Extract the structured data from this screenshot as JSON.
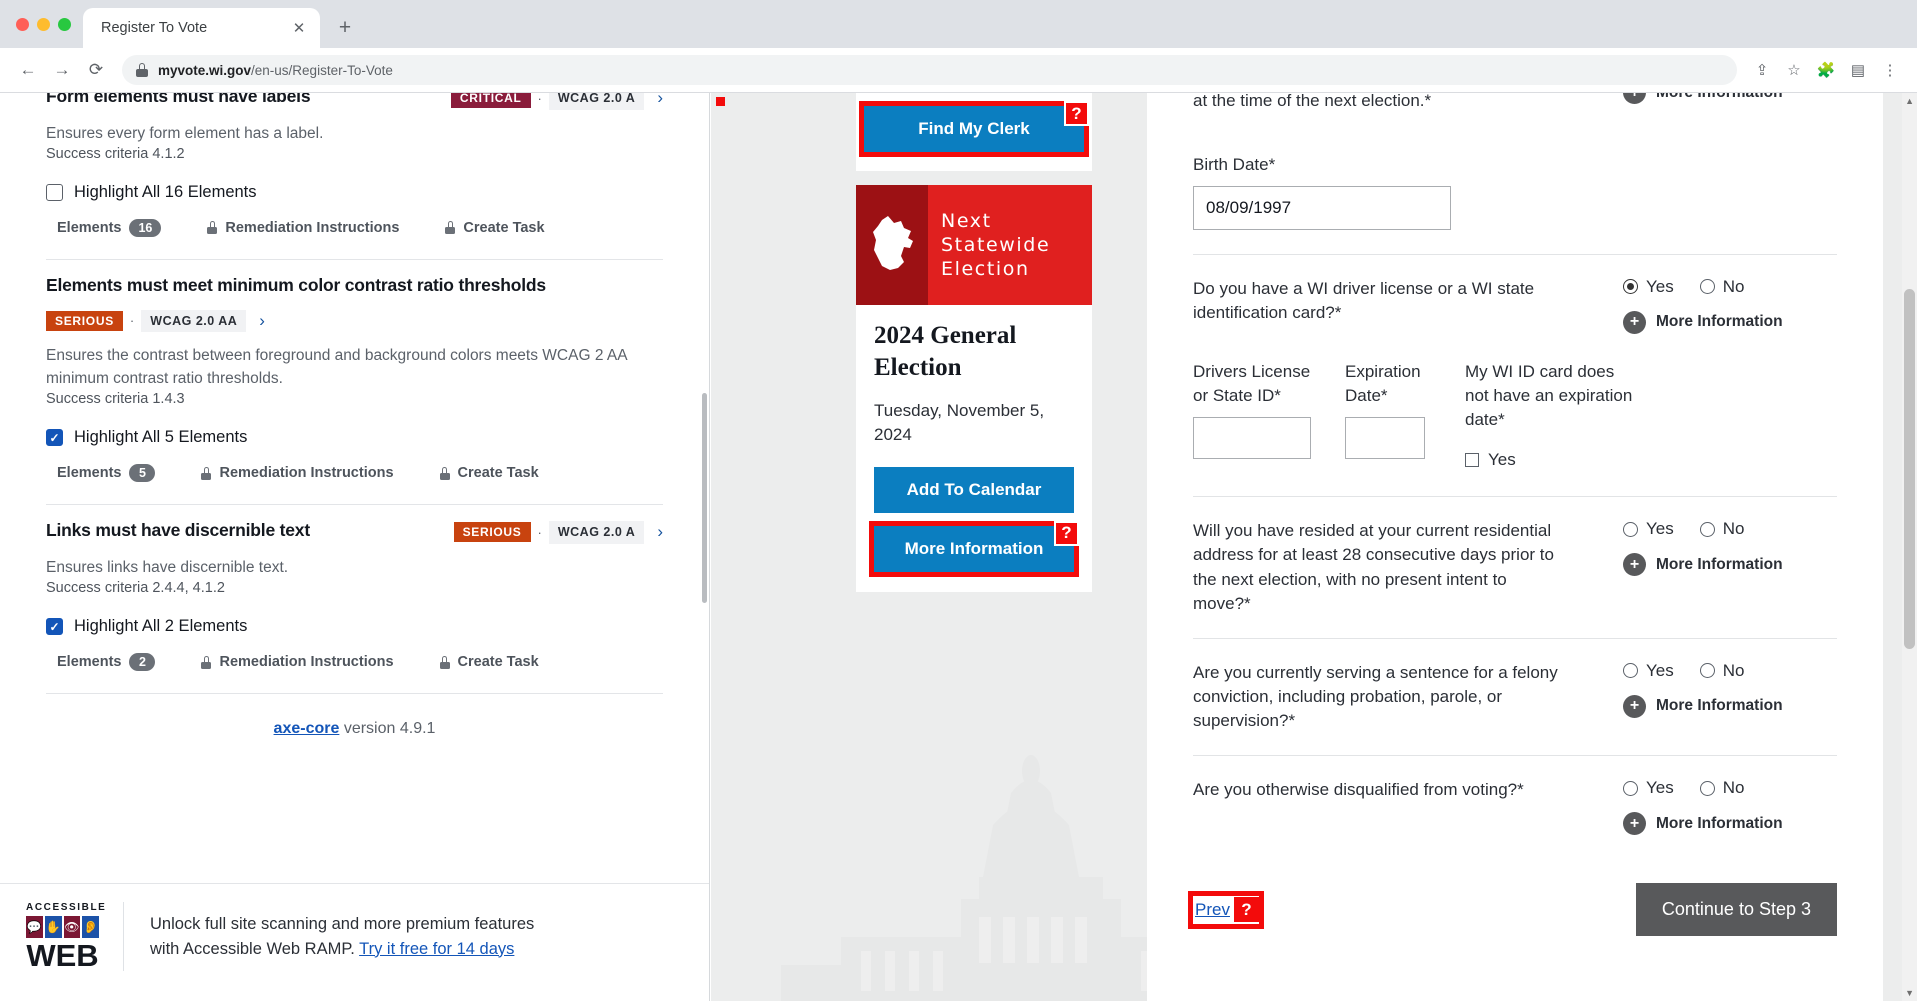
{
  "browser": {
    "tab_title": "Register To Vote",
    "close_icon": "close-icon",
    "new_tab_icon": "plus-icon",
    "back_icon": "arrow-left-icon",
    "forward_icon": "arrow-right-icon",
    "reload_icon": "reload-icon",
    "lock_icon": "lock-icon",
    "url_host": "myvote.wi.gov",
    "url_path": "/en-us/Register-To-Vote",
    "share_icon": "share-icon",
    "bookmark_icon": "star-icon",
    "extensions_icon": "puzzle-icon",
    "sidepanel_icon": "side-panel-icon",
    "menu_icon": "kebab-menu-icon",
    "minimize_icon": "chevron-down-icon"
  },
  "axe_panel": {
    "issues": [
      {
        "title": "Form elements must have labels",
        "severity": "CRITICAL",
        "severity_class": "critical",
        "wcag": "WCAG 2.0 A",
        "description": "Ensures every form element has a label.",
        "criteria": "Success criteria 4.1.2",
        "highlight_label": "Highlight All 16 Elements",
        "checked": false,
        "elements_label": "Elements",
        "elements_count": "16",
        "remediation_label": "Remediation Instructions",
        "create_task_label": "Create Task"
      },
      {
        "title": "Elements must meet minimum color contrast ratio thresholds",
        "severity": "SERIOUS",
        "severity_class": "serious",
        "wcag": "WCAG 2.0 AA",
        "description": "Ensures the contrast between foreground and background colors meets WCAG 2 AA minimum contrast ratio thresholds.",
        "criteria": "Success criteria 1.4.3",
        "highlight_label": "Highlight All 5 Elements",
        "checked": true,
        "elements_label": "Elements",
        "elements_count": "5",
        "remediation_label": "Remediation Instructions",
        "create_task_label": "Create Task"
      },
      {
        "title": "Links must have discernible text",
        "severity": "SERIOUS",
        "severity_class": "serious",
        "wcag": "WCAG 2.0 A",
        "description": "Ensures links have discernible text.",
        "criteria": "Success criteria 2.4.4, 4.1.2",
        "highlight_label": "Highlight All 2 Elements",
        "checked": true,
        "elements_label": "Elements",
        "elements_count": "2",
        "remediation_label": "Remediation Instructions",
        "create_task_label": "Create Task"
      }
    ],
    "version_link": "axe-core",
    "version_text": " version 4.9.1",
    "footer": {
      "logo_line1": "ACCESSIBLE",
      "logo_line2": "WEB",
      "tiles": [
        "speech-bubble-icon",
        "hand-icon",
        "eye-icon",
        "ear-icon"
      ],
      "promo_line1": "Unlock full site scanning and more premium features",
      "promo_line2_prefix": "with Accessible Web RAMP. ",
      "promo_link": "Try it free for 14 days"
    }
  },
  "mid_column": {
    "find_clerk_label": "Find My Clerk",
    "axe_marker": "?",
    "election": {
      "banner_title": "Next Statewide Election",
      "state_icon": "wisconsin-state-icon",
      "name": "2024 General Election",
      "date": "Tuesday, November 5, 2024",
      "add_calendar_label": "Add To Calendar",
      "more_info_label": "More Information"
    }
  },
  "form": {
    "clipped_question": "at the time of the next election.*",
    "clipped_more_info": "More Information",
    "birth_date_label": "Birth Date*",
    "birth_date_value": "08/09/1997",
    "questions": [
      {
        "text": "Do you have a WI driver license or a WI state identification card?*",
        "yes": "Yes",
        "no": "No",
        "selected": "yes",
        "more_info": "More Information"
      },
      {
        "text": "Will you have resided at your current residential address for at least 28 consecutive days prior to the next election, with no present intent to move?*",
        "yes": "Yes",
        "no": "No",
        "selected": "none",
        "more_info": "More Information"
      },
      {
        "text": "Are you currently serving a sentence for a felony conviction, including probation, parole, or supervision?*",
        "yes": "Yes",
        "no": "No",
        "selected": "none",
        "more_info": "More Information"
      },
      {
        "text": "Are you otherwise disqualified from voting?*",
        "yes": "Yes",
        "no": "No",
        "selected": "none",
        "more_info": "More Information"
      }
    ],
    "id_block": {
      "dl_label": "Drivers License or State ID*",
      "dl_value": "",
      "exp_label": "Expiration Date*",
      "exp_value": "",
      "noexp_label": "My WI ID card does not have an expiration date*",
      "noexp_check_label": "Yes"
    },
    "prev_label": "Prev",
    "prev_axe_marker": "?",
    "continue_label": "Continue to Step 3"
  },
  "colors": {
    "critical": "#8a1c3b",
    "serious": "#c8430f",
    "axe_highlight": "#f30b0b",
    "brand_blue": "#0b7ec0",
    "election_red": "#e0201f",
    "election_dark_red": "#9c1114",
    "link_blue": "#1355b8"
  }
}
